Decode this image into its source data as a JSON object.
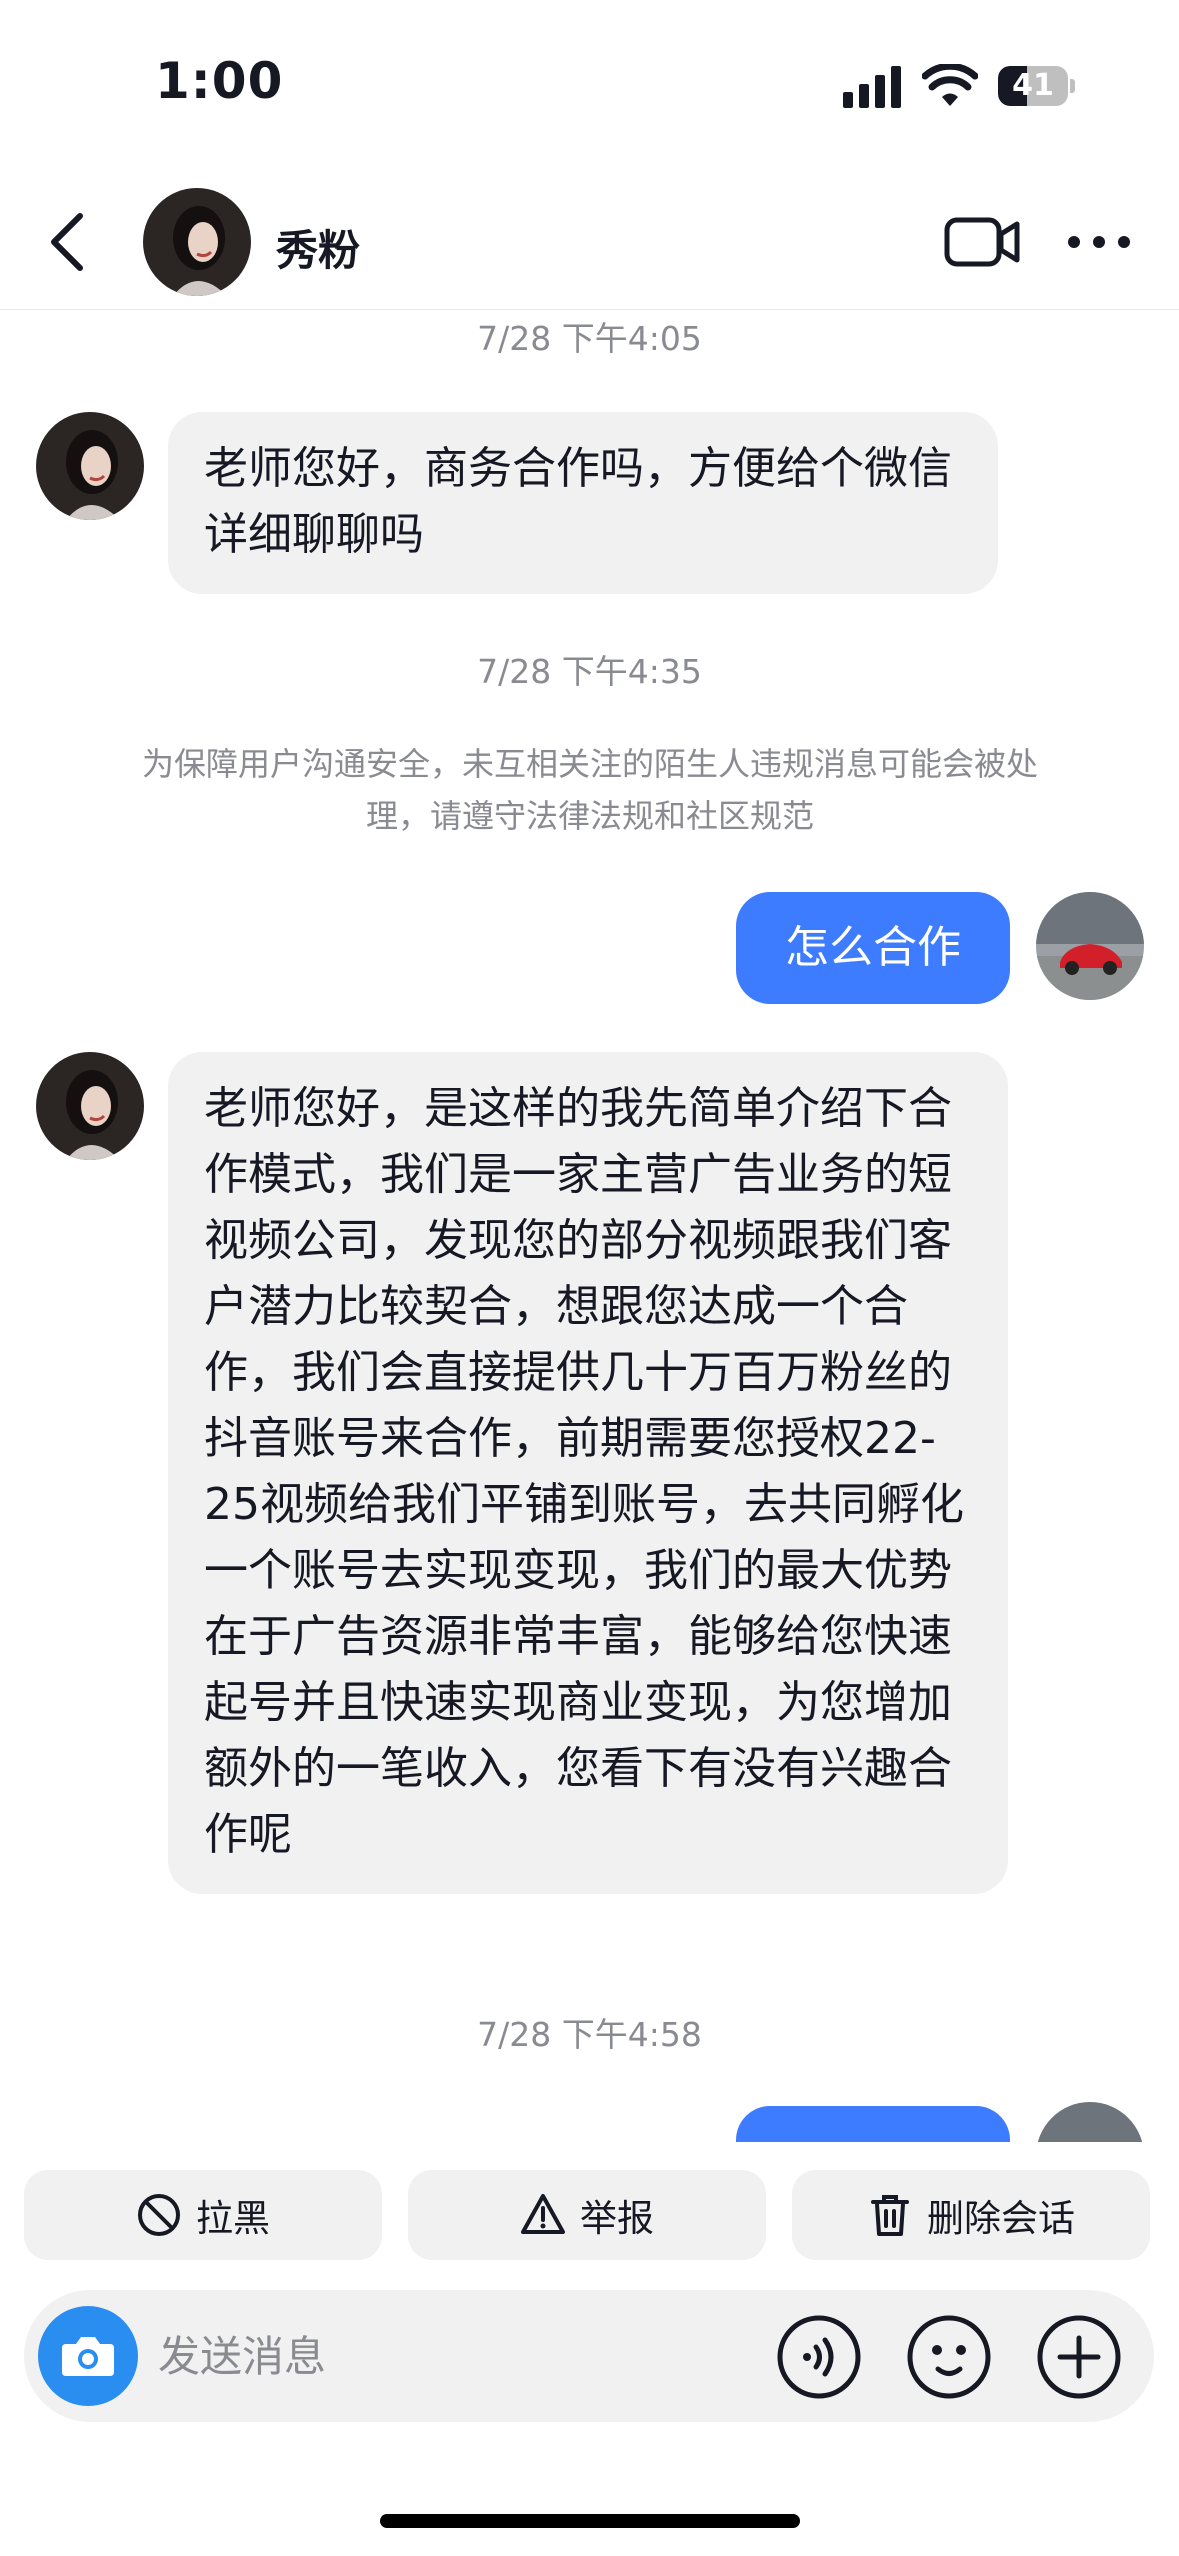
{
  "status_bar": {
    "time": "1:00",
    "battery": "41",
    "battery_level": 0.41
  },
  "header": {
    "name": "秀粉",
    "back_icon": "chevron-left-icon",
    "video_icon": "video-call-icon",
    "more_icon": "more-horizontal-icon"
  },
  "messages": {
    "ts1": "7/28 下午4:05",
    "msg1": "老师您好，商务合作吗，方便给个微信详细聊聊吗",
    "ts2": "7/28 下午4:35",
    "notice": "为保障用户沟通安全，未互相关注的陌生人违规消息可能会被处理，请遵守法律法规和社区规范",
    "out1": "怎么合作",
    "msg2": "老师您好，是这样的我先简单介绍下合作模式，我们是一家主营广告业务的短视频公司，发现您的部分视频跟我们客户潜力比较契合，想跟您达成一个合作，我们会直接提供几十万百万粉丝的抖音账号来合作，前期需要您授权22-25视频给我们平铺到账号，去共同孵化一个账号去实现变现，我们的最大优势在于广告资源非常丰富，能够给您快速起号并且快速实现商业变现，为您增加额外的一笔收入，您看下有没有兴趣合作呢",
    "ts3": "7/28 下午4:58"
  },
  "actions": {
    "block": "拉黑",
    "report": "举报",
    "delete": "删除会话"
  },
  "input": {
    "placeholder": "发送消息"
  },
  "colors": {
    "accent_blue": "#3d7bff",
    "camera_blue": "#2a8ef0",
    "bubble_gray": "#f1f1f2",
    "meta_gray": "#8a8b91"
  }
}
